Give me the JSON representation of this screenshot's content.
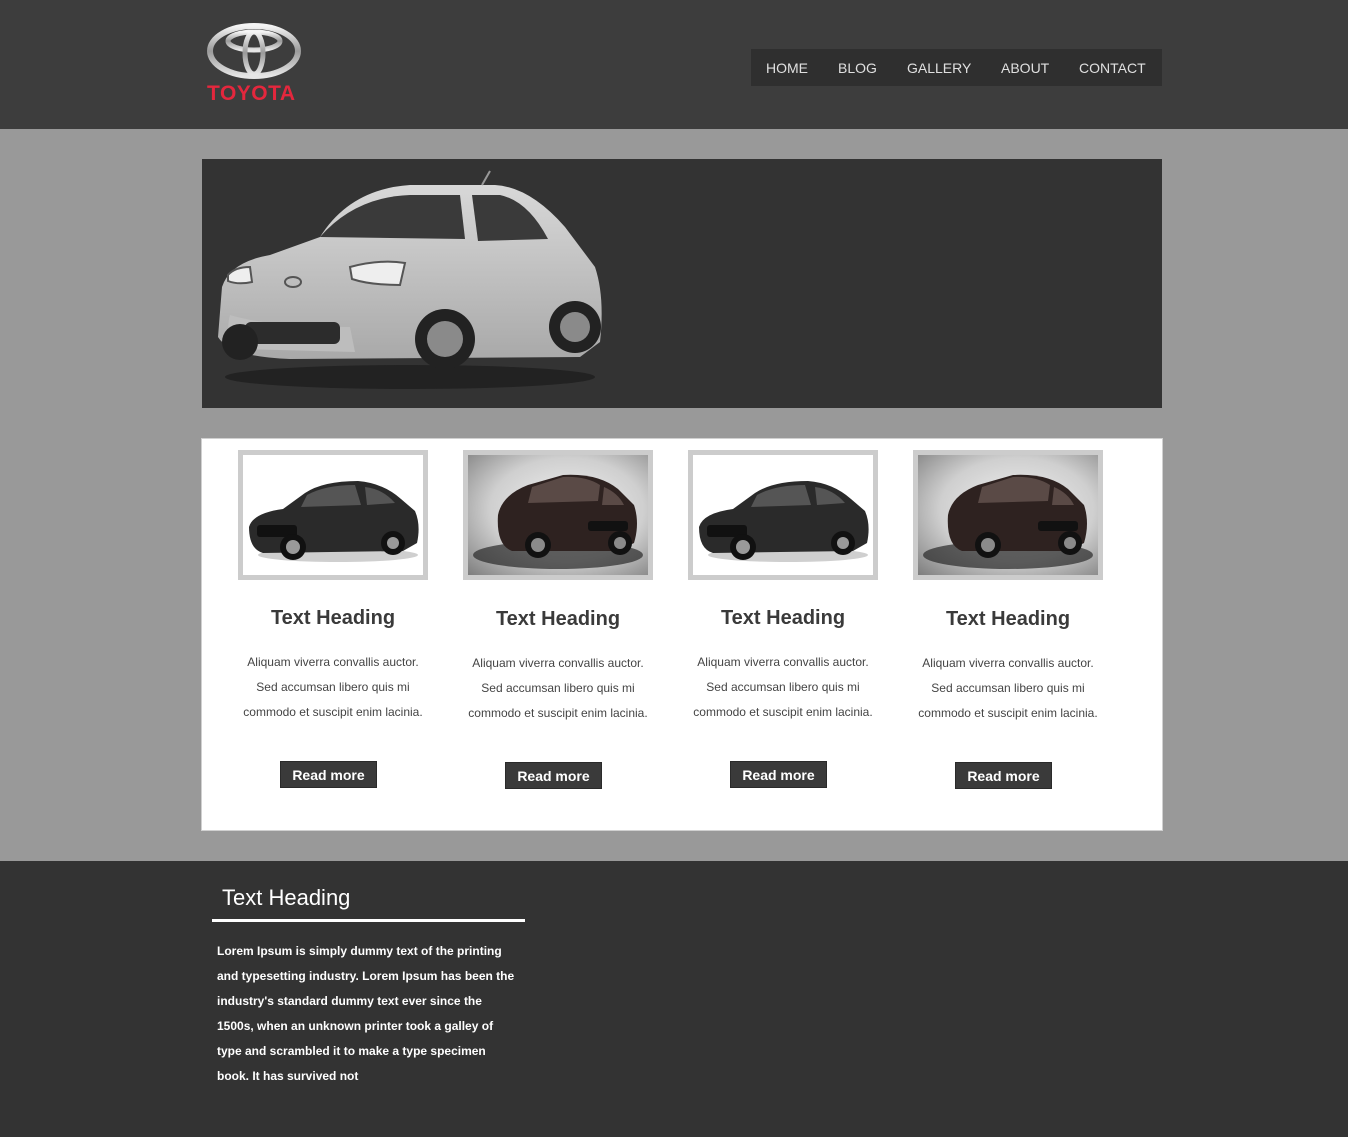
{
  "brand": {
    "name": "TOYOTA",
    "accent_color": "#e4273d"
  },
  "nav": {
    "items": [
      {
        "label": "HOME"
      },
      {
        "label": "BLOG"
      },
      {
        "label": "GALLERY"
      },
      {
        "label": "ABOUT"
      },
      {
        "label": "CONTACT"
      }
    ]
  },
  "hero": {
    "image": "silver-hatchback-car-photo"
  },
  "cards": [
    {
      "image": "black-sedan-photo",
      "heading": "Text Heading",
      "text": "Aliquam viverra convallis auctor. Sed accumsan libero quis mi commodo et suscipit enim lacinia.",
      "button": "Read more"
    },
    {
      "image": "dark-brown-suv-photo",
      "heading": "Text Heading",
      "text": "Aliquam viverra convallis auctor. Sed accumsan libero quis mi commodo et suscipit enim lacinia.",
      "button": "Read more"
    },
    {
      "image": "black-sedan-photo",
      "heading": "Text Heading",
      "text": "Aliquam viverra convallis auctor. Sed accumsan libero quis mi commodo et suscipit enim lacinia.",
      "button": "Read more"
    },
    {
      "image": "dark-brown-suv-photo",
      "heading": "Text Heading",
      "text": "Aliquam viverra convallis auctor. Sed accumsan libero quis mi commodo et suscipit enim lacinia.",
      "button": "Read more"
    }
  ],
  "footer": {
    "heading": "Text Heading",
    "text": "Lorem Ipsum is simply dummy text of the printing and typesetting industry. Lorem Ipsum has been the industry's standard dummy text ever since the 1500s, when an unknown printer took a galley of type and scrambled it to make a type specimen book. It has survived not"
  }
}
